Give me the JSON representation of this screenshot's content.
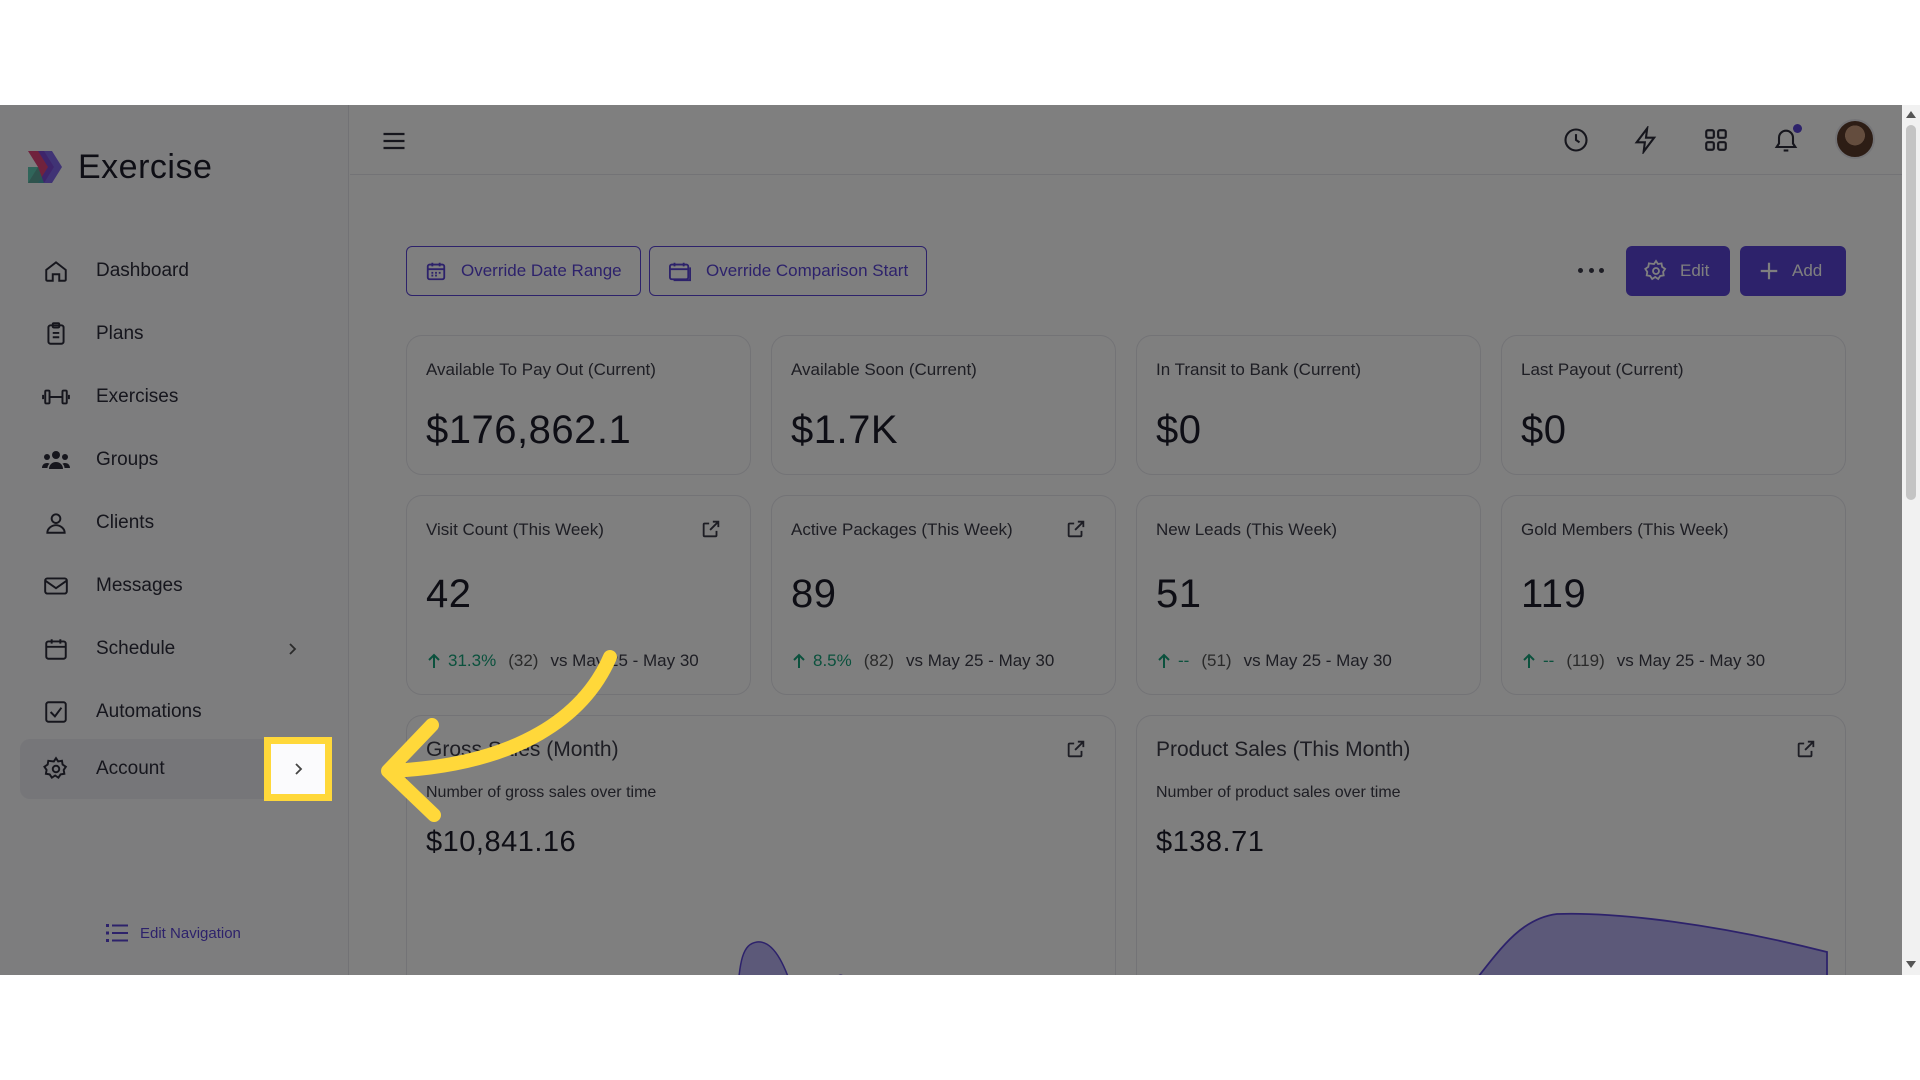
{
  "app": {
    "name": "Exercise"
  },
  "sidebar": {
    "items": [
      {
        "label": "Dashboard",
        "icon": "home-icon"
      },
      {
        "label": "Plans",
        "icon": "clipboard-icon"
      },
      {
        "label": "Exercises",
        "icon": "dumbbell-icon"
      },
      {
        "label": "Groups",
        "icon": "users-icon"
      },
      {
        "label": "Clients",
        "icon": "user-icon"
      },
      {
        "label": "Messages",
        "icon": "mail-icon"
      },
      {
        "label": "Schedule",
        "icon": "calendar-icon"
      },
      {
        "label": "Automations",
        "icon": "checkbox-icon"
      },
      {
        "label": "Account",
        "icon": "gear-icon"
      }
    ],
    "edit_navigation": "Edit Navigation"
  },
  "toolbar": {
    "override_date_range": "Override Date Range",
    "override_comparison_start": "Override Comparison Start",
    "edit": "Edit",
    "add": "Add"
  },
  "metrics": [
    {
      "title": "Available To Pay Out (Current)",
      "value": "$176,862.1"
    },
    {
      "title": "Available Soon (Current)",
      "value": "$1.7K"
    },
    {
      "title": "In Transit to Bank (Current)",
      "value": "$0"
    },
    {
      "title": "Last Payout (Current)",
      "value": "$0"
    }
  ],
  "weekly": [
    {
      "title": "Visit Count (This Week)",
      "value": "42",
      "pct": "31.3%",
      "prev": "(32)",
      "range": "vs May 25 - May 30"
    },
    {
      "title": "Active Packages (This Week)",
      "value": "89",
      "pct": "8.5%",
      "prev": "(82)",
      "range": "vs May 25 - May 30"
    },
    {
      "title": "New Leads (This Week)",
      "value": "51",
      "pct": "--",
      "prev": "(51)",
      "range": "vs May 25 - May 30"
    },
    {
      "title": "Gold Members (This Week)",
      "value": "119",
      "pct": "--",
      "prev": "(119)",
      "range": "vs May 25 - May 30"
    }
  ],
  "charts": [
    {
      "title": "Gross Sales (Month)",
      "subtitle": "Number of gross sales over time",
      "value": "$10,841.16"
    },
    {
      "title": "Product Sales (This Month)",
      "subtitle": "Number of product sales over time",
      "value": "$138.71"
    }
  ],
  "colors": {
    "accent": "#5b45d6",
    "positive": "#16a37a",
    "highlight": "#ffd83a"
  }
}
